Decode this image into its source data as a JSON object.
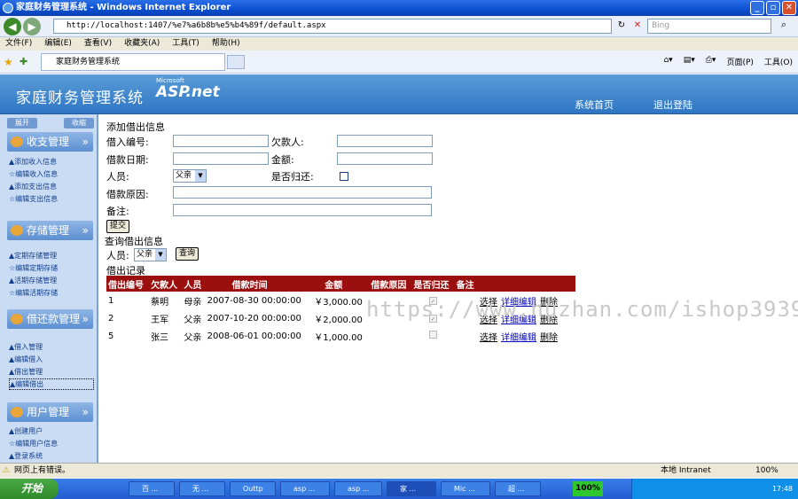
{
  "window": {
    "title": "家庭财务管理系统 - Windows Internet Explorer"
  },
  "browser": {
    "address": "http://localhost:1407/%e7%a6b8b%e5%b4%89f/default.aspx",
    "search_placeholder": "Bing",
    "menus": [
      "文件(F)",
      "编辑(E)",
      "查看(V)",
      "收藏夹(A)",
      "工具(T)",
      "帮助(H)"
    ],
    "tab_title": "家庭财务管理系统",
    "cmd_page": "页面(P)",
    "cmd_tools": "工具(O)"
  },
  "header": {
    "site_title": "家庭财务管理系统",
    "asp_brand": "ASP.net",
    "asp_vendor": "Microsoft",
    "nav_home": "系统首页",
    "nav_logout": "退出登陆"
  },
  "sidebar": {
    "expand_label": "展开",
    "collapse_label": "收缩",
    "sections": [
      {
        "title": "收支管理",
        "items": [
          "▲添加收入信息",
          "☆编辑收入信息",
          "▲添加支出信息",
          "☆编辑支出信息"
        ]
      },
      {
        "title": "存储管理",
        "items": [
          "▲定期存储管理",
          "☆编辑定期存储",
          "▲活期存储管理",
          "☆编辑活期存储"
        ]
      },
      {
        "title": "借还款管理",
        "items": [
          "▲借入管理",
          "▲编辑借入",
          "▲借出管理",
          "▲编辑借出"
        ]
      },
      {
        "title": "用户管理",
        "items": [
          "▲创建用户",
          "☆编辑用户信息",
          "▲登录系统"
        ]
      }
    ]
  },
  "form": {
    "heading": "添加借出信息",
    "id_label": "借入编号:",
    "debtor_label": "欠款人:",
    "date_label": "借款日期:",
    "amount_label": "金额:",
    "person_label": "人员:",
    "person_value": "父亲",
    "returned_label": "是否归还:",
    "reason_label": "借款原因:",
    "remark_label": "备注:",
    "submit_label": "提交"
  },
  "query": {
    "heading": "查询借出信息",
    "person_label": "人员:",
    "person_value": "父亲",
    "button_label": "查询"
  },
  "records": {
    "heading": "借出记录",
    "columns": [
      "借出编号",
      "欠款人",
      "人员",
      "借款时间",
      "金额",
      "借款原因",
      "是否归还",
      "备注"
    ],
    "rows": [
      {
        "id": "1",
        "debtor": "蔡明",
        "person": "母亲",
        "date": "2007-08-30 00:00:00",
        "amount": "￥3,000.00",
        "reason": "",
        "returned": true,
        "remark": ""
      },
      {
        "id": "2",
        "debtor": "王军",
        "person": "父亲",
        "date": "2007-10-20 00:00:00",
        "amount": "￥2,000.00",
        "reason": "",
        "returned": true,
        "remark": ""
      },
      {
        "id": "5",
        "debtor": "张三",
        "person": "父亲",
        "date": "2008-06-01 00:00:00",
        "amount": "￥1,000.00",
        "reason": "",
        "returned": false,
        "remark": ""
      }
    ],
    "actions": {
      "select": "选择",
      "edit": "详细编辑",
      "delete": "删除"
    }
  },
  "watermark": "https://www.huzhan.com/ishop39397",
  "status": {
    "left": "网页上有错误。",
    "zone": "本地 Intranet",
    "zoom": "100%"
  },
  "taskbar": {
    "start": "开始",
    "items": [
      "百 ...",
      "无 ...",
      "Outtp",
      "asp ...",
      "asp ...",
      "家 ...",
      "Mic ...",
      "超 ..."
    ],
    "progress": "100%",
    "clock": "17:48"
  }
}
